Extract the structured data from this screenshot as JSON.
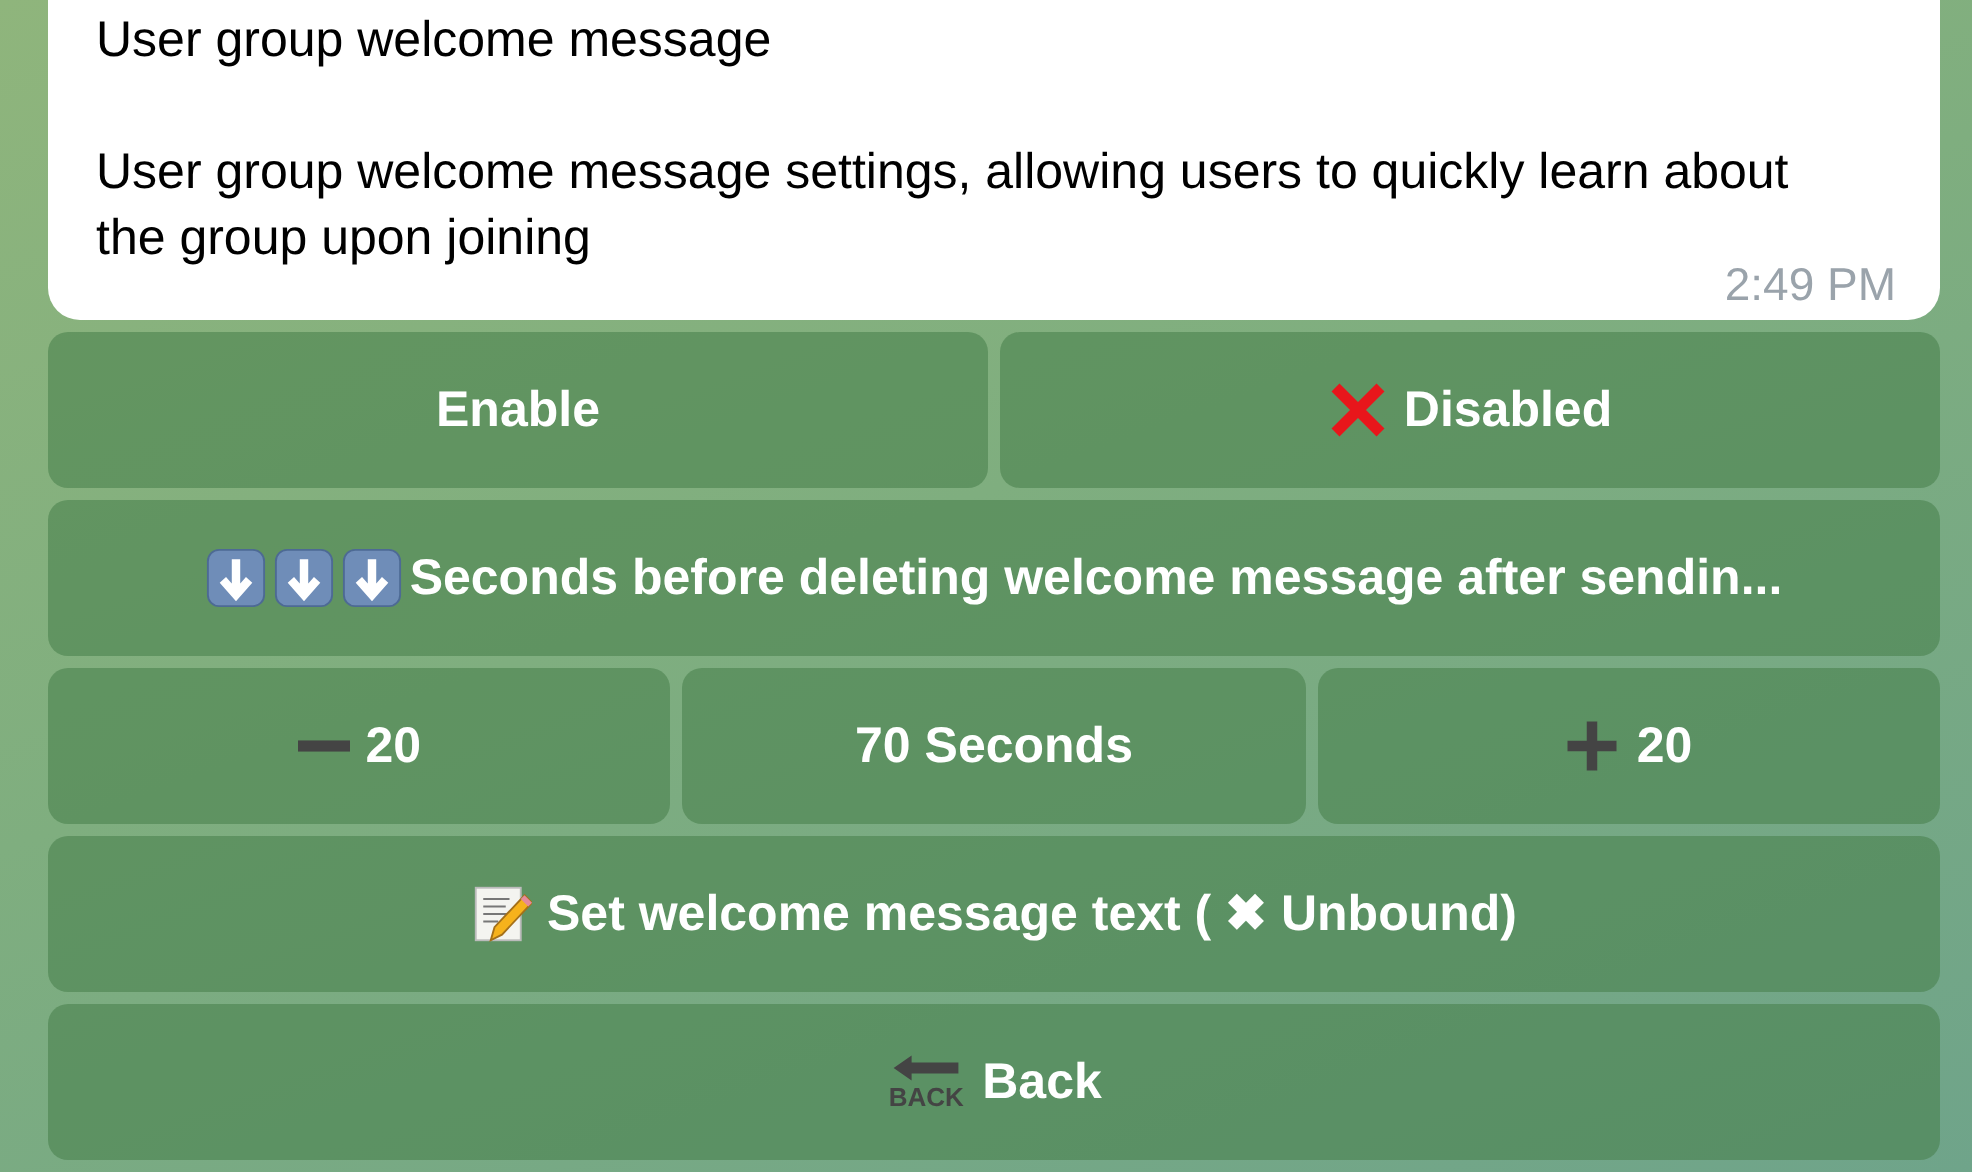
{
  "message": {
    "title": "User group welcome message",
    "body": "User group welcome message settings, allowing users to quickly learn about the group upon joining",
    "time": "2:49 PM"
  },
  "keyboard": [
    [
      {
        "label": "Enable"
      },
      {
        "label": "Disabled",
        "icons": [
          {
            "kind": "cross"
          }
        ]
      }
    ],
    [
      {
        "label": "Seconds before deleting welcome message after sendin...",
        "icons": [
          {
            "kind": "down"
          },
          {
            "kind": "down"
          },
          {
            "kind": "down"
          }
        ]
      }
    ],
    [
      {
        "label": "20",
        "icons": [
          {
            "kind": "minus"
          }
        ]
      },
      {
        "label": "70 Seconds"
      },
      {
        "label": "20",
        "icons": [
          {
            "kind": "plus"
          }
        ]
      }
    ],
    [
      {
        "label": "Set welcome message text ( ✖ Unbound)",
        "icons": [
          {
            "kind": "memo"
          }
        ]
      }
    ],
    [
      {
        "label": "Back",
        "icons": [
          {
            "kind": "back"
          }
        ],
        "icon_text": "BACK"
      }
    ]
  ]
}
